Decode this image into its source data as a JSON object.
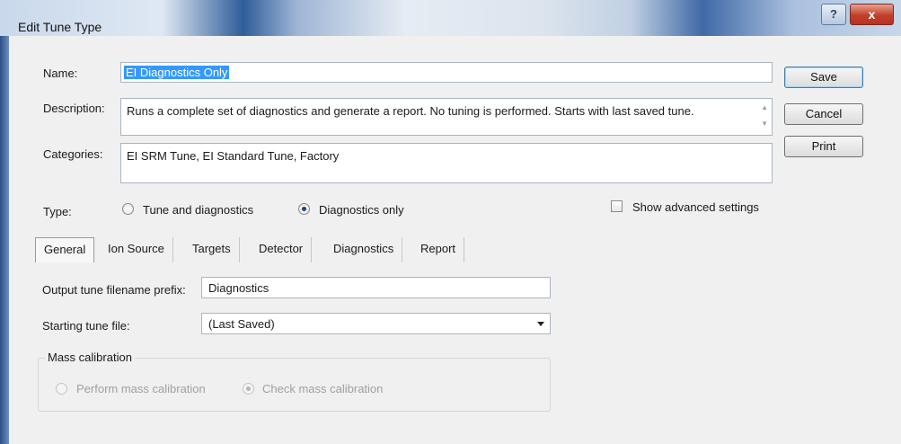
{
  "window": {
    "title": "Edit Tune Type",
    "help_glyph": "?",
    "close_glyph": "x"
  },
  "form": {
    "name_label": "Name:",
    "name_value": "EI Diagnostics Only",
    "description_label": "Description:",
    "description_value": "Runs a complete set of diagnostics and generate a report. No tuning is performed. Starts with last saved tune.",
    "categories_label": "Categories:",
    "categories_value": "EI SRM Tune, EI Standard Tune, Factory",
    "type_label": "Type:",
    "type_options": [
      "Tune and diagnostics",
      "Diagnostics only"
    ],
    "type_selected": "Diagnostics only",
    "show_advanced_label": "Show advanced settings",
    "show_advanced_checked": false
  },
  "buttons": {
    "save": "Save",
    "cancel": "Cancel",
    "print": "Print"
  },
  "tabs": [
    {
      "label": "General",
      "active": true
    },
    {
      "label": "Ion Source",
      "active": false
    },
    {
      "label": "Targets",
      "active": false
    },
    {
      "label": "Detector",
      "active": false
    },
    {
      "label": "Diagnostics",
      "active": false
    },
    {
      "label": "Report",
      "active": false
    }
  ],
  "general": {
    "prefix_label": "Output tune filename prefix:",
    "prefix_value": "Diagnostics",
    "starting_label": "Starting tune file:",
    "starting_value": "(Last Saved)",
    "mass_cal_group": "Mass calibration",
    "mass_cal_options": [
      "Perform mass calibration",
      "Check mass calibration"
    ],
    "mass_cal_selected": "Check mass calibration",
    "mass_cal_enabled": false
  },
  "colors": {
    "title_gradient_accent": "#2f5d9a",
    "close_button": "#c0402c",
    "selection": "#3399ff",
    "dialog_background": "#f0f0f0"
  }
}
